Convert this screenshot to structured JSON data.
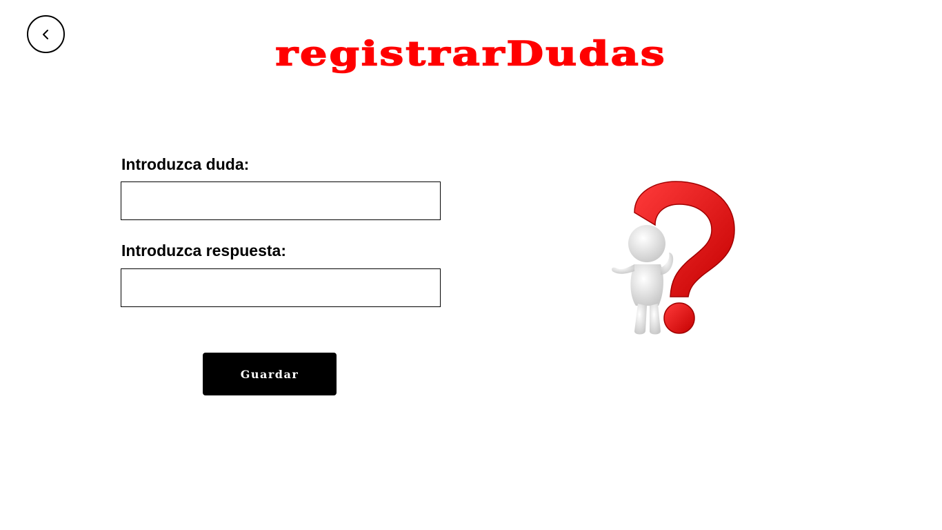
{
  "header": {
    "title": "registrarDudas",
    "back_icon": "chevron-left-icon"
  },
  "form": {
    "question_label": "Introduzca duda:",
    "question_value": "",
    "answer_label": "Introduzca respuesta:",
    "answer_value": "",
    "save_label": "Guardar"
  },
  "illustration": {
    "icon": "question-mark-figure-icon"
  },
  "colors": {
    "title": "#ff0000",
    "button_bg": "#000000",
    "button_text": "#ffffff",
    "question_mark": "#ee1111"
  }
}
